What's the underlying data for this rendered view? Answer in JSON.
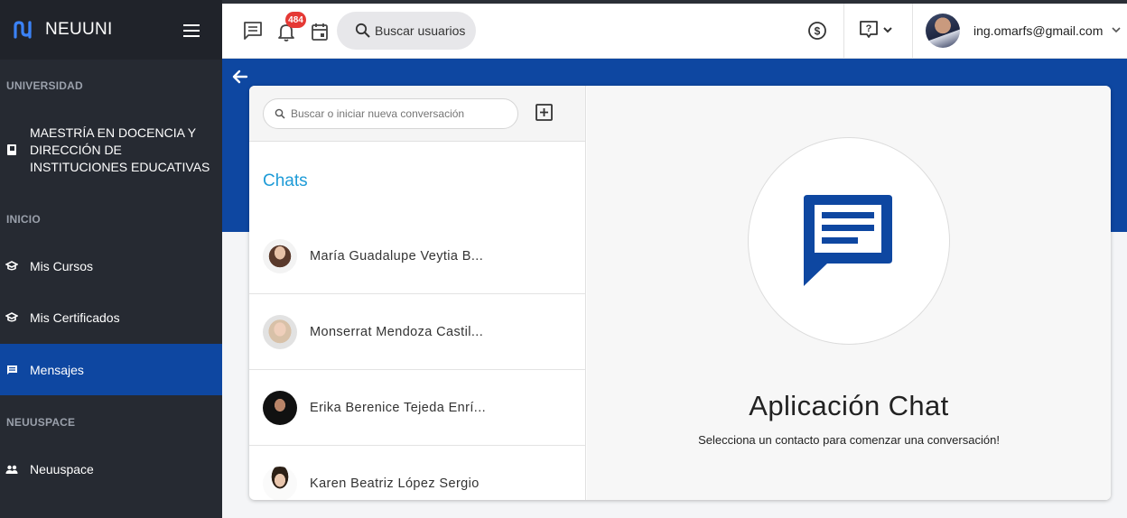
{
  "brand": {
    "name": "NEUUNI",
    "accent": "#0e47a1"
  },
  "sidebar": {
    "sections": [
      {
        "label": "UNIVERSIDAD"
      },
      {
        "label": "INICIO"
      },
      {
        "label": "NEUUSPACE"
      }
    ],
    "items": [
      {
        "label": "MAESTRÍA EN DOCENCIA Y DIRECCIÓN DE INSTITUCIONES EDUCATIVAS",
        "icon": "book-icon"
      },
      {
        "label": "Mis Cursos",
        "icon": "graduation-cap-icon"
      },
      {
        "label": "Mis Certificados",
        "icon": "graduation-cap-icon"
      },
      {
        "label": "Mensajes",
        "icon": "message-icon",
        "active": true
      },
      {
        "label": "Neuuspace",
        "icon": "people-icon"
      }
    ]
  },
  "header": {
    "notification_count": "484",
    "search_label": "Buscar usuarios",
    "user_email": "ing.omarfs@gmail.com"
  },
  "chat_list": {
    "search_placeholder": "Buscar o iniciar nueva conversación",
    "title": "Chats",
    "conversations": [
      {
        "name": "María Guadalupe Veytia B..."
      },
      {
        "name": "Monserrat Mendoza Castil..."
      },
      {
        "name": "Erika Berenice Tejeda Enrí..."
      },
      {
        "name": "Karen Beatriz López Sergio"
      }
    ]
  },
  "chat_app": {
    "title": "Aplicación Chat",
    "subtitle": "Selecciona un contacto para comenzar una conversación!"
  }
}
